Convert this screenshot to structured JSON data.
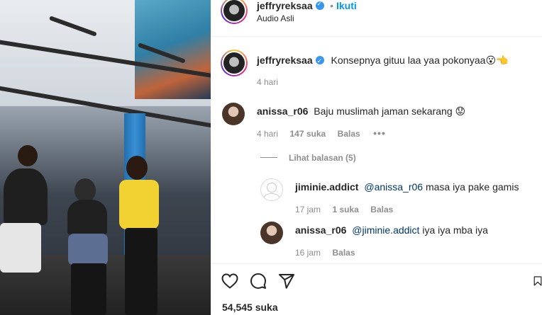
{
  "post": {
    "username": "jeffryreksaa",
    "follow_label": "Ikuti",
    "audio_label": "Audio Asli",
    "caption": {
      "username": "jeffryreksaa",
      "text": "Konsepnya gituu laa yaa pokonyaa😮👈",
      "time": "4 hari"
    }
  },
  "comments": [
    {
      "username": "anissa_r06",
      "text": "Baju muslimah jaman sekarang 😟",
      "time": "4 hari",
      "likes": "147 suka",
      "reply_label": "Balas",
      "more_icon": "more-dots-icon",
      "view_replies": "Lihat balasan (5)",
      "replies": [
        {
          "username": "jiminie.addict",
          "mention": "@anissa_r06",
          "text": " masa iya pake gamis",
          "time": "17 jam",
          "likes": "1 suka",
          "reply_label": "Balas"
        },
        {
          "username": "anissa_r06",
          "mention": "@jiminie.addict",
          "text": " iya iya mba iya",
          "time": "16 jam",
          "reply_label": "Balas"
        }
      ]
    }
  ],
  "actions": {
    "like_icon": "heart-icon",
    "comment_icon": "comment-icon",
    "share_icon": "send-icon",
    "save_icon": "bookmark-icon",
    "likes_count": "54,545 suka"
  },
  "colors": {
    "accent": "#0095f6",
    "verified": "#3897f0",
    "muted": "#8e8e8e",
    "text": "#262626"
  }
}
